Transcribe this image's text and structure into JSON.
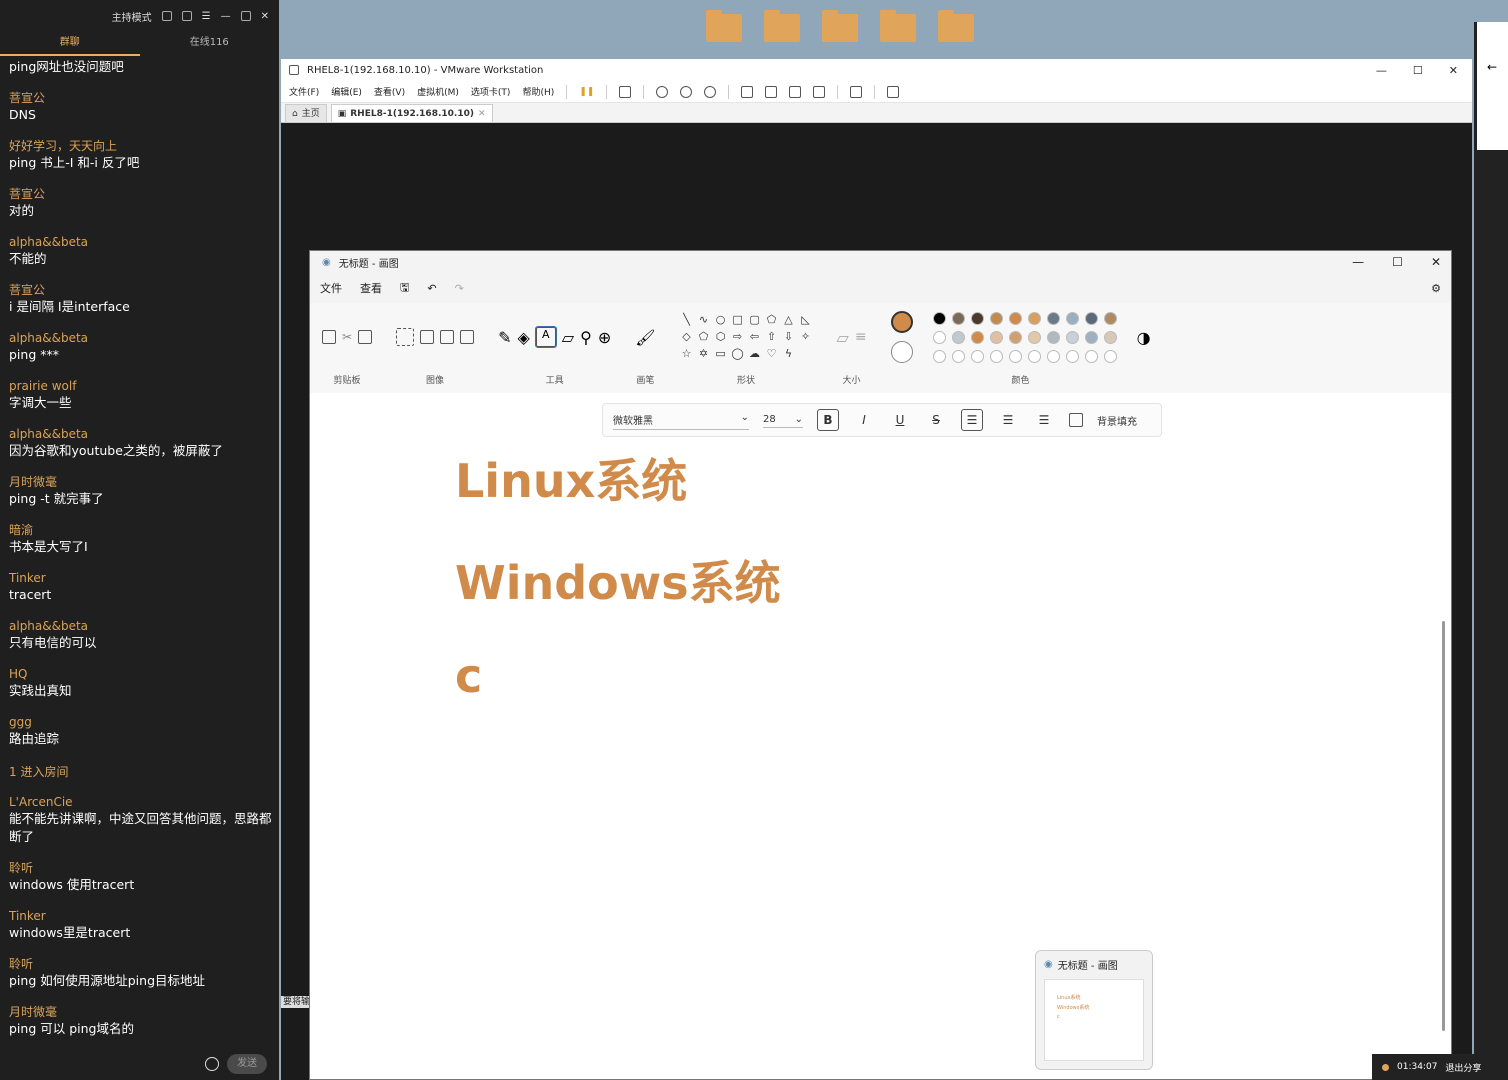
{
  "chat": {
    "header": {
      "mode": "主持模式"
    },
    "tabs": [
      "群聊",
      "在线116"
    ],
    "first_line": "ping网址也没问题吧",
    "messages": [
      {
        "user": "菩宣公",
        "text": "DNS"
      },
      {
        "user": "好好学习，天天向上",
        "text": "ping 书上-I  和-i 反了吧"
      },
      {
        "user": "菩宣公",
        "text": "对的"
      },
      {
        "user": "alpha&&beta",
        "text": "不能的"
      },
      {
        "user": "菩宣公",
        "text": "i 是间隔 I是interface"
      },
      {
        "user": "alpha&&beta",
        "text": "ping  ***"
      },
      {
        "user": "prairie wolf",
        "text": "字调大一些"
      },
      {
        "user": "alpha&&beta",
        "text": "因为谷歌和youtube之类的，被屏蔽了"
      },
      {
        "user": "月时微毫",
        "text": "ping   -t  就完事了"
      },
      {
        "user": "暗渝",
        "text": "书本是大写了I"
      },
      {
        "user": "Tinker",
        "text": "tracert"
      },
      {
        "user": "alpha&&beta",
        "text": "只有电信的可以"
      },
      {
        "user": "HQ",
        "text": "实践出真知"
      },
      {
        "user": "ggg",
        "text": "路由追踪"
      }
    ],
    "join_notice": "1 进入房间",
    "messages2": [
      {
        "user": "L'ArcenCie",
        "text": "能不能先讲课啊，中途又回答其他问题，思路都断了"
      },
      {
        "user": "聆听",
        "text": "windows 使用tracert"
      },
      {
        "user": "Tinker",
        "text": "windows里是tracert"
      },
      {
        "user": "聆听",
        "text": "ping 如何使用源地址ping目标地址"
      },
      {
        "user": "月时微毫",
        "text": "ping 可以 ping域名的"
      }
    ],
    "send_label": "发送"
  },
  "desktop_icons": [
    "",
    "",
    "",
    "",
    ""
  ],
  "vmware": {
    "title": "RHEL8-1(192.168.10.10) - VMware Workstation",
    "menus": [
      "文件(F)",
      "编辑(E)",
      "查看(V)",
      "虚拟机(M)",
      "选项卡(T)",
      "帮助(H)"
    ],
    "tabs": [
      {
        "label": "主页"
      },
      {
        "label": "RHEL8-1(192.168.10.10)"
      }
    ],
    "status": "要将输"
  },
  "paint": {
    "title": "无标题 - 画图",
    "menus": [
      "文件",
      "查看"
    ],
    "groups": [
      "剪贴板",
      "图像",
      "工具",
      "画笔",
      "形状",
      "大小",
      "颜色"
    ],
    "font_name": "微软雅黑",
    "font_size": "28",
    "bg_fill_label": "背景填充",
    "canvas_lines": [
      "Linux系统",
      "Windows系统",
      "c"
    ],
    "text_color": "#d08a4a",
    "swatch_colors": [
      "#000000",
      "#7a6a5a",
      "#4a3a2a",
      "#c08a50",
      "#d08a4a",
      "#d8a060",
      "#6a7a8a",
      "#9ab0c0",
      "#5a6a7a",
      "#b08a60",
      "#ffffff",
      "#c0c8d0",
      "#d08a4a",
      "#e0c0a0",
      "#d0a070",
      "#e0c8a8",
      "#b0b8c0",
      "#c8d0d8",
      "#a0b0c0",
      "#d8c8b8",
      "#ffffff",
      "#ffffff",
      "#ffffff",
      "#ffffff",
      "#ffffff",
      "#ffffff",
      "#ffffff",
      "#ffffff",
      "#ffffff",
      "#ffffff"
    ]
  },
  "thumbnail": {
    "title": "无标题 - 画图",
    "lines": [
      "Linux系统",
      "Windows系统",
      "c"
    ]
  },
  "statusbar": {
    "timer": "01:34:07",
    "exit": "退出分享"
  }
}
